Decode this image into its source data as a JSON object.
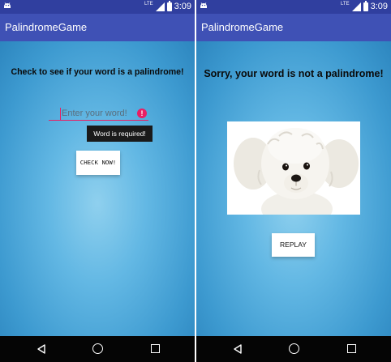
{
  "status_bar": {
    "network_label": "LTE",
    "time": "3:09"
  },
  "left_screen": {
    "app_title": "PalindromeGame",
    "prompt": "Check to see if your word is a palindrome!",
    "word_input": {
      "value": "",
      "placeholder": "Enter your word!"
    },
    "error_tooltip": "Word is required!",
    "check_button_label": "CHECK NOW!"
  },
  "right_screen": {
    "app_title": "PalindromeGame",
    "result_message": "Sorry, your word is not a palindrome!",
    "result_image": "white-puppy",
    "replay_button_label": "REPLAY"
  },
  "colors": {
    "status_bar": "#303f9f",
    "app_bar": "#3f51b5",
    "accent": "#e91e63",
    "background": "#4aa3d6",
    "nav_bar": "#050505"
  },
  "icons": [
    "android-icon",
    "signal-icon",
    "battery-icon",
    "nav-back-icon",
    "nav-home-icon",
    "nav-recent-icon",
    "error-icon"
  ]
}
